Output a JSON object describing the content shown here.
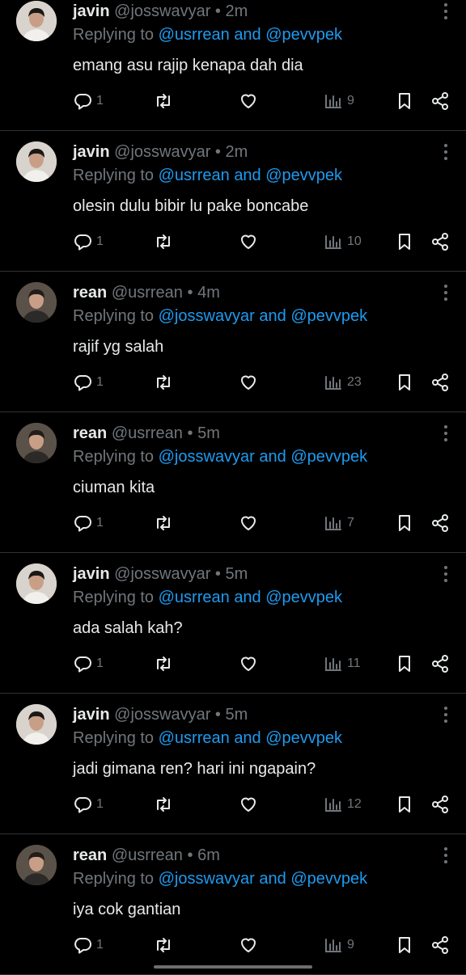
{
  "reply_prefix": "Replying to",
  "conjunction": "and",
  "dot": "•",
  "tweets": [
    {
      "name": "javin",
      "handle": "@josswavyar",
      "time": "2m",
      "mentions": [
        "@usrrean",
        "@pevvpek"
      ],
      "text": "emang asu rajip kenapa dah dia",
      "replies": "1",
      "views": "9",
      "avatar": "javin"
    },
    {
      "name": "javin",
      "handle": "@josswavyar",
      "time": "2m",
      "mentions": [
        "@usrrean",
        "@pevvpek"
      ],
      "text": "olesin dulu bibir lu pake boncabe",
      "replies": "1",
      "views": "10",
      "avatar": "javin"
    },
    {
      "name": "rean",
      "handle": "@usrrean",
      "time": "4m",
      "mentions": [
        "@josswavyar",
        "@pevvpek"
      ],
      "text": "rajif yg salah",
      "replies": "1",
      "views": "23",
      "avatar": "rean"
    },
    {
      "name": "rean",
      "handle": "@usrrean",
      "time": "5m",
      "mentions": [
        "@josswavyar",
        "@pevvpek"
      ],
      "text": "ciuman kita",
      "replies": "1",
      "views": "7",
      "avatar": "rean"
    },
    {
      "name": "javin",
      "handle": "@josswavyar",
      "time": "5m",
      "mentions": [
        "@usrrean",
        "@pevvpek"
      ],
      "text": "ada salah kah?",
      "replies": "1",
      "views": "11",
      "avatar": "javin"
    },
    {
      "name": "javin",
      "handle": "@josswavyar",
      "time": "5m",
      "mentions": [
        "@usrrean",
        "@pevvpek"
      ],
      "text": "jadi gimana ren? hari ini ngapain?",
      "replies": "1",
      "views": "12",
      "avatar": "javin"
    },
    {
      "name": "rean",
      "handle": "@usrrean",
      "time": "6m",
      "mentions": [
        "@josswavyar",
        "@pevvpek"
      ],
      "text": "iya cok gantian",
      "replies": "1",
      "views": "9",
      "avatar": "rean"
    }
  ],
  "colors": {
    "background": "#000000",
    "text": "#e7e9ea",
    "muted": "#71767b",
    "link": "#1d9bf0",
    "divider": "#2f3336"
  },
  "icons": [
    "reply-icon",
    "retweet-icon",
    "like-icon",
    "views-icon",
    "bookmark-icon",
    "share-icon",
    "more-icon"
  ]
}
